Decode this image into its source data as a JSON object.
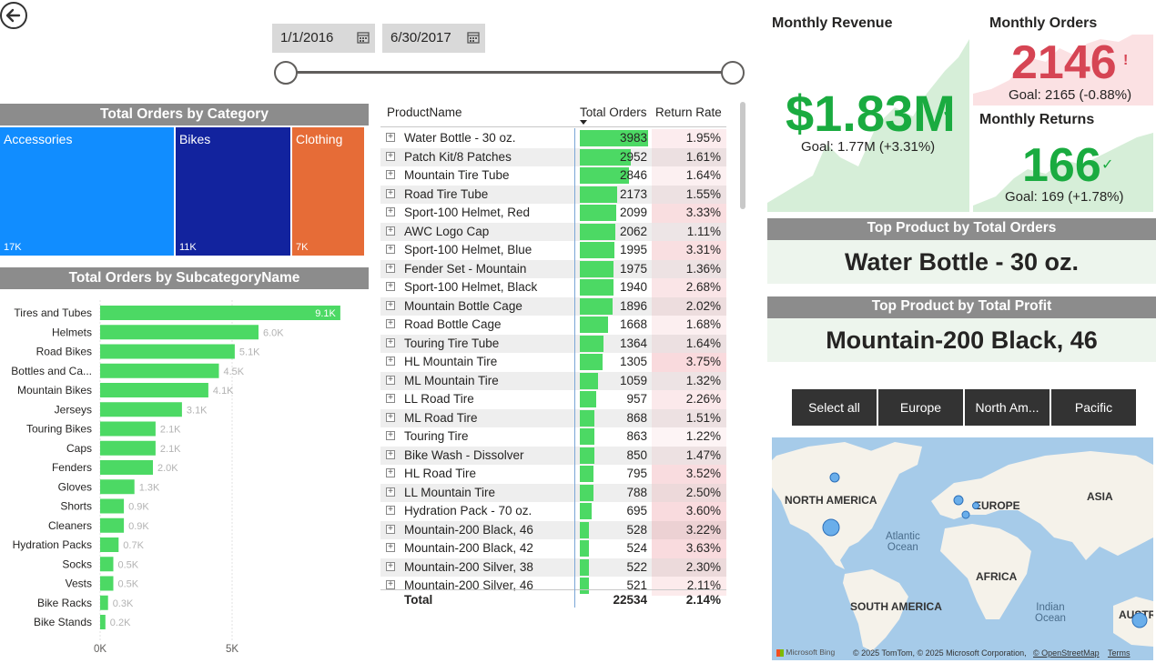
{
  "date_slicer": {
    "start": "1/1/2016",
    "end": "6/30/2017"
  },
  "category_chart": {
    "title": "Total Orders by Category",
    "tiles": [
      {
        "label": "Accessories",
        "value": "17K",
        "color": "#118dff"
      },
      {
        "label": "Bikes",
        "value": "11K",
        "color": "#12239e"
      },
      {
        "label": "Clothing",
        "value": "7K",
        "color": "#e66c37"
      }
    ]
  },
  "chart_data": {
    "type": "bar",
    "title": "Total Orders by SubcategoryName",
    "categories": [
      "Tires and Tubes",
      "Helmets",
      "Road Bikes",
      "Bottles and Ca...",
      "Mountain Bikes",
      "Jerseys",
      "Touring Bikes",
      "Caps",
      "Fenders",
      "Gloves",
      "Shorts",
      "Cleaners",
      "Hydration Packs",
      "Socks",
      "Vests",
      "Bike Racks",
      "Bike Stands"
    ],
    "values": [
      9100,
      6000,
      5100,
      4500,
      4100,
      3100,
      2100,
      2100,
      2000,
      1300,
      900,
      900,
      700,
      500,
      500,
      300,
      200
    ],
    "data_labels": [
      "9.1K",
      "6.0K",
      "5.1K",
      "4.5K",
      "4.1K",
      "3.1K",
      "2.1K",
      "2.1K",
      "2.0K",
      "1.3K",
      "0.9K",
      "0.9K",
      "0.7K",
      "0.5K",
      "0.5K",
      "0.3K",
      "0.2K"
    ],
    "x_ticks": [
      "0K",
      "5K"
    ],
    "xlim": [
      0,
      10000
    ],
    "bar_color": "#4cd964",
    "grid": true
  },
  "table": {
    "headers": {
      "product": "ProductName",
      "orders": "Total Orders",
      "rate": "Return Rate"
    },
    "max_orders": 3983,
    "rows": [
      {
        "name": "Water Bottle - 30 oz.",
        "orders": "3983",
        "rate": "1.95%",
        "ov": 3983,
        "rv": 1.95
      },
      {
        "name": "Patch Kit/8 Patches",
        "orders": "2952",
        "rate": "1.61%",
        "ov": 2952,
        "rv": 1.61
      },
      {
        "name": "Mountain Tire Tube",
        "orders": "2846",
        "rate": "1.64%",
        "ov": 2846,
        "rv": 1.64
      },
      {
        "name": "Road Tire Tube",
        "orders": "2173",
        "rate": "1.55%",
        "ov": 2173,
        "rv": 1.55
      },
      {
        "name": "Sport-100 Helmet, Red",
        "orders": "2099",
        "rate": "3.33%",
        "ov": 2099,
        "rv": 3.33
      },
      {
        "name": "AWC Logo Cap",
        "orders": "2062",
        "rate": "1.11%",
        "ov": 2062,
        "rv": 1.11
      },
      {
        "name": "Sport-100 Helmet, Blue",
        "orders": "1995",
        "rate": "3.31%",
        "ov": 1995,
        "rv": 3.31
      },
      {
        "name": "Fender Set - Mountain",
        "orders": "1975",
        "rate": "1.36%",
        "ov": 1975,
        "rv": 1.36
      },
      {
        "name": "Sport-100 Helmet, Black",
        "orders": "1940",
        "rate": "2.68%",
        "ov": 1940,
        "rv": 2.68
      },
      {
        "name": "Mountain Bottle Cage",
        "orders": "1896",
        "rate": "2.02%",
        "ov": 1896,
        "rv": 2.02
      },
      {
        "name": "Road Bottle Cage",
        "orders": "1668",
        "rate": "1.68%",
        "ov": 1668,
        "rv": 1.68
      },
      {
        "name": "Touring Tire Tube",
        "orders": "1364",
        "rate": "1.64%",
        "ov": 1364,
        "rv": 1.64
      },
      {
        "name": "HL Mountain Tire",
        "orders": "1305",
        "rate": "3.75%",
        "ov": 1305,
        "rv": 3.75
      },
      {
        "name": "ML Mountain Tire",
        "orders": "1059",
        "rate": "1.32%",
        "ov": 1059,
        "rv": 1.32
      },
      {
        "name": "LL Road Tire",
        "orders": "957",
        "rate": "2.26%",
        "ov": 957,
        "rv": 2.26
      },
      {
        "name": "ML Road Tire",
        "orders": "868",
        "rate": "1.51%",
        "ov": 868,
        "rv": 1.51
      },
      {
        "name": "Touring Tire",
        "orders": "863",
        "rate": "1.22%",
        "ov": 863,
        "rv": 1.22
      },
      {
        "name": "Bike Wash - Dissolver",
        "orders": "850",
        "rate": "1.47%",
        "ov": 850,
        "rv": 1.47
      },
      {
        "name": "HL Road Tire",
        "orders": "795",
        "rate": "3.52%",
        "ov": 795,
        "rv": 3.52
      },
      {
        "name": "LL Mountain Tire",
        "orders": "788",
        "rate": "2.50%",
        "ov": 788,
        "rv": 2.5
      },
      {
        "name": "Hydration Pack - 70 oz.",
        "orders": "695",
        "rate": "3.60%",
        "ov": 695,
        "rv": 3.6
      },
      {
        "name": "Mountain-200 Black, 46",
        "orders": "528",
        "rate": "3.22%",
        "ov": 528,
        "rv": 3.22
      },
      {
        "name": "Mountain-200 Black, 42",
        "orders": "524",
        "rate": "3.63%",
        "ov": 524,
        "rv": 3.63
      },
      {
        "name": "Mountain-200 Silver, 38",
        "orders": "522",
        "rate": "2.30%",
        "ov": 522,
        "rv": 2.3
      },
      {
        "name": "Mountain-200 Silver, 46",
        "orders": "521",
        "rate": "2.11%",
        "ov": 521,
        "rv": 2.11
      }
    ],
    "total": {
      "label": "Total",
      "orders": "22534",
      "rate": "2.14%"
    }
  },
  "kpi": {
    "revenue": {
      "title": "Monthly Revenue",
      "value": "$1.83M",
      "status": "✓",
      "goal": "Goal: 1.77M (+3.31%)",
      "color": "#1aab40"
    },
    "orders": {
      "title": "Monthly Orders",
      "value": "2146",
      "status": "!",
      "goal": "Goal: 2165 (-0.88%)",
      "color": "#d64554"
    },
    "returns": {
      "title": "Monthly Returns",
      "value": "166",
      "status": "✓",
      "goal": "Goal: 169 (+1.78%)",
      "color": "#1aab40"
    }
  },
  "top_product_orders": {
    "title": "Top Product by Total Orders",
    "value": "Water Bottle - 30 oz."
  },
  "top_product_profit": {
    "title": "Top Product by Total Profit",
    "value": "Mountain-200 Black, 46"
  },
  "region_slicer": [
    "Select all",
    "Europe",
    "North Am...",
    "Pacific"
  ],
  "map": {
    "labels": {
      "na": "NORTH AMERICA",
      "eu": "EUROPE",
      "asia": "ASIA",
      "africa": "AFRICA",
      "sa": "SOUTH AMERICA",
      "aus": "AUSTR"
    },
    "atlantic": [
      "Atlantic",
      "Ocean"
    ],
    "indian": [
      "Indian",
      "Ocean"
    ],
    "brand": "Microsoft Bing",
    "copyright": "© 2025 TomTom, © 2025 Microsoft Corporation,",
    "osm": "© OpenStreetMap",
    "terms": "Terms"
  },
  "icons": {
    "back": "back-arrow-icon",
    "calendar": "calendar-icon",
    "check": "checkmark-icon",
    "alert": "exclamation-icon",
    "expand": "expand-plus-icon",
    "sort": "sort-desc-icon"
  }
}
